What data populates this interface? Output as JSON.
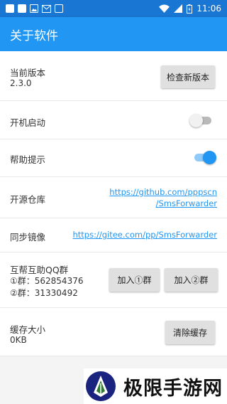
{
  "status_bar": {
    "time": "11:06"
  },
  "toolbar": {
    "title": "关于软件",
    "color": "#2196f3"
  },
  "rows": {
    "version": {
      "title": "当前版本",
      "value": "2.3.0",
      "button": "检查新版本"
    },
    "autostart": {
      "title": "开机启动",
      "enabled": false
    },
    "help_tips": {
      "title": "帮助提示",
      "enabled": true
    },
    "repo": {
      "title": "开源仓库",
      "link": "https://github.com/pppscn/SmsForwarder",
      "link_line1": "https://github.com/pppscn",
      "link_line2": "/SmsForwarder"
    },
    "mirror": {
      "title": "同步镜像",
      "link": "https://gitee.com/pp/SmsForwarder"
    },
    "qq_group": {
      "title": "互帮互助QQ群",
      "group1": "①群：562854376",
      "group2": "②群：31330492",
      "join1_button": "加入①群",
      "join2_button": "加入②群"
    },
    "cache": {
      "title": "缓存大小",
      "value": "0KB",
      "button": "清除缓存"
    }
  },
  "watermark": {
    "text": "极限手游网",
    "logo_icon": "pen-nib-logo"
  }
}
